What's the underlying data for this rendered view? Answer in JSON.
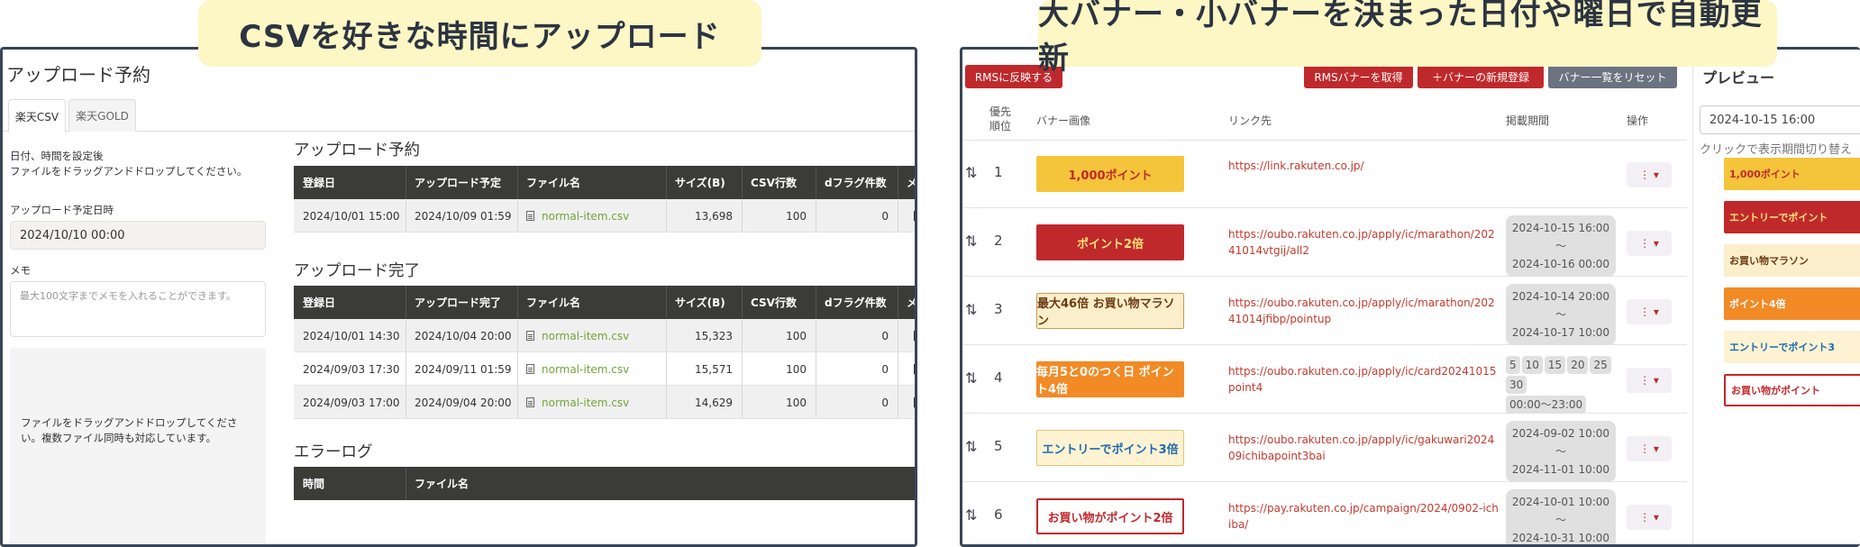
{
  "callouts": {
    "left": "CSVを好きな時間にアップロード",
    "right": "大バナー・小バナーを決まった日付や曜日で自動更新"
  },
  "left_panel": {
    "title": "アップロード予約",
    "tabs": [
      "楽天CSV",
      "楽天GOLD"
    ],
    "instructions": [
      "日付、時間を設定後",
      "ファイルをドラッグアンドドロップしてください。"
    ],
    "date_label": "アップロード予定日時",
    "date_value": "2024/10/10 00:00",
    "memo_label": "メモ",
    "memo_placeholder": "最大100文字までメモを入れることができます。",
    "dropzone_text": "ファイルをドラッグアンドドロップしてください。複数ファイル同時も対応しています。",
    "reserved": {
      "heading": "アップロード予約",
      "columns": [
        "登録日",
        "アップロード予定",
        "ファイル名",
        "サイズ(B)",
        "CSV行数",
        "dフラグ件数",
        "メモ"
      ],
      "rows": [
        [
          "2024/10/01 15:00",
          "2024/10/09 01:59",
          "normal-item.csv",
          "13,698",
          "100",
          "0",
          "【お"
        ]
      ]
    },
    "completed": {
      "heading": "アップロード完了",
      "columns": [
        "登録日",
        "アップロード完了",
        "ファイル名",
        "サイズ(B)",
        "CSV行数",
        "dフラグ件数",
        "メモ"
      ],
      "rows": [
        [
          "2024/10/01 14:30",
          "2024/10/04 20:00",
          "normal-item.csv",
          "15,323",
          "100",
          "0",
          "【お"
        ],
        [
          "2024/09/03 17:30",
          "2024/09/11 01:59",
          "normal-item.csv",
          "15,571",
          "100",
          "0",
          "【楽"
        ],
        [
          "2024/09/03 17:00",
          "2024/09/04 20:00",
          "normal-item.csv",
          "14,629",
          "100",
          "0",
          "【楽"
        ]
      ]
    },
    "errors": {
      "heading": "エラーログ",
      "columns": [
        "時間",
        "ファイル名"
      ]
    }
  },
  "right_panel": {
    "buttons": {
      "reflect": "RMSに反映する",
      "fetch": "RMSバナーを取得",
      "new": "＋バナーの新規登録",
      "reset": "バナー一覧をリセット"
    },
    "columns": [
      "優先順位",
      "バナー画像",
      "リンク先",
      "掲載期間",
      "操作"
    ],
    "op_label": "⋮ ▾",
    "rows": [
      {
        "prio": "1",
        "banner": "1,000ポイント",
        "link": "https://link.rakuten.co.jp/",
        "period": null
      },
      {
        "prio": "2",
        "banner": "ポイント2倍",
        "link": "https://oubo.rakuten.co.jp/apply/ic/marathon/20241014vtgij/all2",
        "period": [
          "2024-10-15 16:00",
          "〜",
          "2024-10-16 00:00"
        ]
      },
      {
        "prio": "3",
        "banner": "最大46倍 お買い物マラソン",
        "link": "https://oubo.rakuten.co.jp/apply/ic/marathon/20241014jfibp/pointup",
        "period": [
          "2024-10-14 20:00",
          "〜",
          "2024-10-17 10:00"
        ]
      },
      {
        "prio": "4",
        "banner": "毎月5と0のつく日 ポイント4倍",
        "link": "https://oubo.rakuten.co.jp/apply/ic/card20241015point4",
        "days": [
          "5",
          "10",
          "15",
          "20",
          "25",
          "30"
        ],
        "time": "00:00〜23:00"
      },
      {
        "prio": "5",
        "banner": "エントリーでポイント3倍",
        "link": "https://oubo.rakuten.co.jp/apply/ic/gakuwari202409ichibapoint3bai",
        "period": [
          "2024-09-02 10:00",
          "〜",
          "2024-11-01 10:00"
        ]
      },
      {
        "prio": "6",
        "banner": "お買い物がポイント2倍",
        "link": "https://pay.rakuten.co.jp/campaign/2024/0902-ichiba/",
        "period": [
          "2024-10-01 10:00",
          "〜",
          "2024-10-31 10:00"
        ]
      }
    ],
    "preview": {
      "title": "プレビュー",
      "date": "2024-10-15 16:00",
      "note": "クリックで表示期間切り替え",
      "banners": [
        "1,000ポイント",
        "エントリーでポイント",
        "お買い物マラソン",
        "ポイント4倍",
        "エントリーでポイント3",
        "お買い物がポイント"
      ]
    }
  },
  "colors": {
    "accent_red": "#c0292c",
    "link_red": "#c33a2e",
    "file_green": "#73a53a",
    "table_header": "#3b3b38",
    "callout_bg": "#fdf7c6"
  }
}
